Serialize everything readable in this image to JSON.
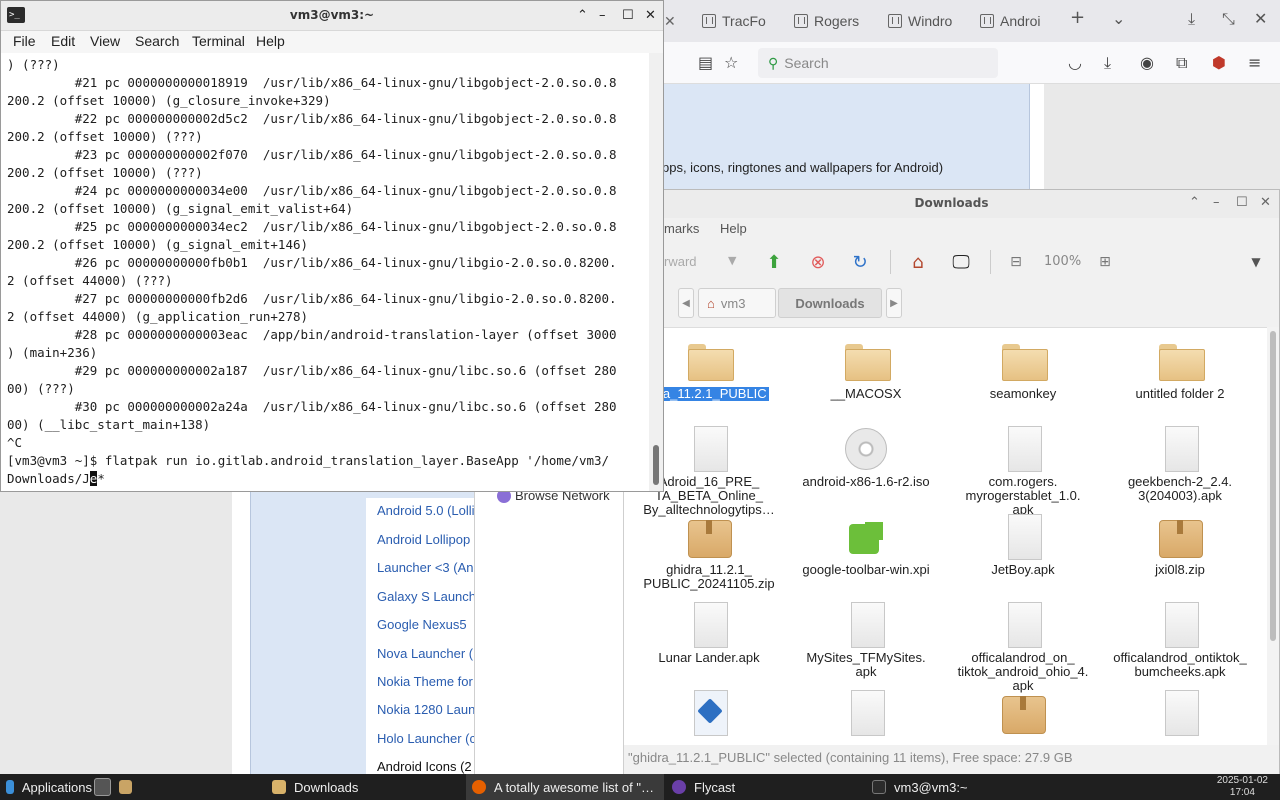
{
  "browser": {
    "tabs": [
      {
        "label": "TracFo"
      },
      {
        "label": "Rogers"
      },
      {
        "label": "Windro"
      },
      {
        "label": "Androi"
      }
    ],
    "search_placeholder": "Search",
    "page_description": "pps, icons, ringtones and wallpapers for Android)",
    "links": [
      "Android 5.0 (Lolli",
      "Android Lollipop",
      "Launcher <3 (An",
      "Galaxy S Launch",
      "Google Nexus5",
      "Nova Launcher (",
      "Nokia Theme for",
      "Nokia 1280 Laun",
      "Holo Launcher (c",
      "Android Icons (2"
    ]
  },
  "terminal": {
    "title": "vm3@vm3:~",
    "menu": [
      "File",
      "Edit",
      "View",
      "Search",
      "Terminal",
      "Help"
    ],
    "lines": [
      ") (???)",
      "         #21 pc 0000000000018919  /usr/lib/x86_64-linux-gnu/libgobject-2.0.so.0.8",
      "200.2 (offset 10000) (g_closure_invoke+329)",
      "         #22 pc 000000000002d5c2  /usr/lib/x86_64-linux-gnu/libgobject-2.0.so.0.8",
      "200.2 (offset 10000) (???)",
      "         #23 pc 000000000002f070  /usr/lib/x86_64-linux-gnu/libgobject-2.0.so.0.8",
      "200.2 (offset 10000) (???)",
      "         #24 pc 0000000000034e00  /usr/lib/x86_64-linux-gnu/libgobject-2.0.so.0.8",
      "200.2 (offset 10000) (g_signal_emit_valist+64)",
      "         #25 pc 0000000000034ec2  /usr/lib/x86_64-linux-gnu/libgobject-2.0.so.0.8",
      "200.2 (offset 10000) (g_signal_emit+146)",
      "         #26 pc 00000000000fb0b1  /usr/lib/x86_64-linux-gnu/libgio-2.0.so.0.8200.",
      "2 (offset 44000) (???)",
      "         #27 pc 00000000000fb2d6  /usr/lib/x86_64-linux-gnu/libgio-2.0.so.0.8200.",
      "2 (offset 44000) (g_application_run+278)",
      "         #28 pc 0000000000003eac  /app/bin/android-translation-layer (offset 3000",
      ") (main+236)",
      "         #29 pc 000000000002a187  /usr/lib/x86_64-linux-gnu/libc.so.6 (offset 280",
      "00) (???)",
      "         #30 pc 000000000002a24a  /usr/lib/x86_64-linux-gnu/libc.so.6 (offset 280",
      "00) (__libc_start_main+138)",
      "^C",
      "[vm3@vm3 ~]$ flatpak run io.gitlab.android_translation_layer.BaseApp '/home/vm3/"
    ],
    "last_line_prefix": "Downloads/J",
    "cursor_char": "e",
    "last_line_suffix": "*"
  },
  "filemanager": {
    "title": "Downloads",
    "menu": [
      "marks",
      "Help"
    ],
    "forward_label": "rward",
    "zoom": "100%",
    "crumbs": [
      "vm3",
      "Downloads"
    ],
    "sidebar_item": "Browse Network",
    "status": "\"ghidra_11.2.1_PUBLIC\" selected (containing 11 items), Free space: 27.9 GB",
    "items": [
      {
        "label": "dra_11.2.1_PUBLIC",
        "icon": "folder-icon",
        "selected": true
      },
      {
        "label": "__MACOSX",
        "icon": "folder-icon"
      },
      {
        "label": "seamonkey",
        "icon": "folder-icon"
      },
      {
        "label": "untitled folder 2",
        "icon": "folder-icon"
      },
      {
        "label": "Adroid_16_PRE_\nTA_BETA_Online_\nBy_alltechnologytips…",
        "icon": "document-icon"
      },
      {
        "label": "android-x86-1.6-r2.iso",
        "icon": "disc-icon"
      },
      {
        "label": "com.rogers.\nmyrogerstablet_1.0.\napk",
        "icon": "document-icon"
      },
      {
        "label": "geekbench-2_2.4.\n3(204003).apk",
        "icon": "document-icon"
      },
      {
        "label": "ghidra_11.2.1_\nPUBLIC_20241105.zip",
        "icon": "archive-icon"
      },
      {
        "label": "google-toolbar-win.xpi",
        "icon": "puzzle-icon"
      },
      {
        "label": "JetBoy.apk",
        "icon": "document-icon"
      },
      {
        "label": "jxi0l8.zip",
        "icon": "archive-icon"
      },
      {
        "label": "Lunar Lander.apk",
        "icon": "document-icon"
      },
      {
        "label": "MySites_TFMySites.\napk",
        "icon": "document-icon"
      },
      {
        "label": "officalandrod_on_\ntiktok_android_ohio_4.\napk",
        "icon": "document-icon"
      },
      {
        "label": "officalandrod_ontiktok_\nbumcheeks.apk",
        "icon": "document-icon"
      },
      {
        "label": "",
        "icon": "package-icon"
      },
      {
        "label": "",
        "icon": "document-icon"
      },
      {
        "label": "",
        "icon": "archive-icon"
      },
      {
        "label": "",
        "icon": "document-icon"
      }
    ]
  },
  "taskbar": {
    "applications": "Applications",
    "tasks": [
      {
        "label": "Downloads"
      },
      {
        "label": "A totally awesome list of \"…"
      },
      {
        "label": "Flycast"
      },
      {
        "label": "vm3@vm3:~"
      }
    ],
    "date": "2025-01-02",
    "time": "17:04"
  }
}
